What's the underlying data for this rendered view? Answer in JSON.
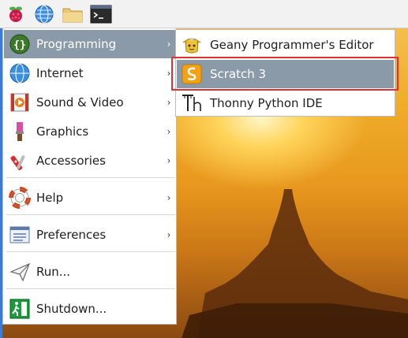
{
  "panel": {
    "icons": [
      "raspberry-menu-icon",
      "web-browser-icon",
      "file-manager-icon",
      "terminal-icon"
    ]
  },
  "menu": {
    "items": [
      {
        "label": "Programming",
        "icon": "programming-icon",
        "has_submenu": true,
        "active": true
      },
      {
        "label": "Internet",
        "icon": "internet-icon",
        "has_submenu": true
      },
      {
        "label": "Sound & Video",
        "icon": "sound-video-icon",
        "has_submenu": true
      },
      {
        "label": "Graphics",
        "icon": "graphics-icon",
        "has_submenu": true
      },
      {
        "label": "Accessories",
        "icon": "accessories-icon",
        "has_submenu": true
      },
      {
        "label": "Help",
        "icon": "help-icon",
        "has_submenu": true
      },
      {
        "label": "Preferences",
        "icon": "preferences-icon",
        "has_submenu": true
      },
      {
        "label": "Run...",
        "icon": "run-icon",
        "has_submenu": false
      },
      {
        "label": "Shutdown...",
        "icon": "shutdown-icon",
        "has_submenu": false
      }
    ],
    "arrow": "›"
  },
  "submenu": {
    "items": [
      {
        "label": "Geany Programmer's Editor",
        "icon": "geany-icon"
      },
      {
        "label": "Scratch 3",
        "icon": "scratch-icon",
        "active": true
      },
      {
        "label": "Thonny Python IDE",
        "icon": "thonny-icon"
      }
    ]
  },
  "colors": {
    "active_bg": "#8a9aa8",
    "highlight": "#e23030",
    "panel_bg": "#f2f2f2"
  }
}
